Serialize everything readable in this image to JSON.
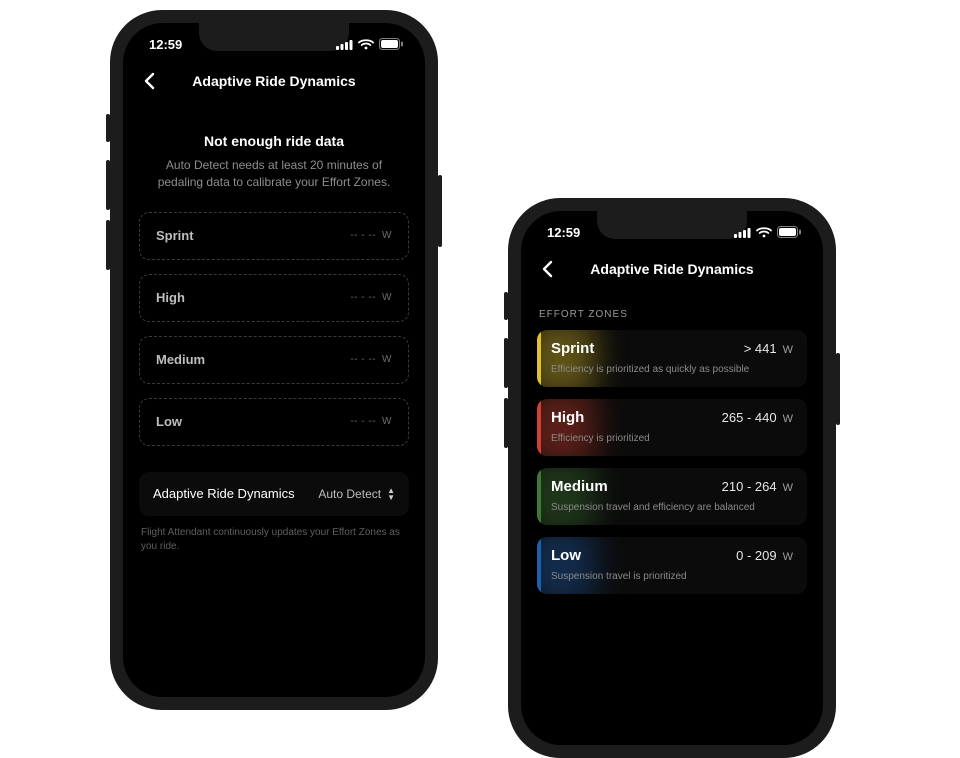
{
  "phoneA": {
    "status": {
      "time": "12:59"
    },
    "nav": {
      "title": "Adaptive Ride Dynamics"
    },
    "empty": {
      "title": "Not enough ride data",
      "subtitle": "Auto Detect needs at least 20 minutes of pedaling data to calibrate your Effort Zones."
    },
    "zones": [
      {
        "name": "Sprint",
        "value": "-- - --",
        "unit": "W"
      },
      {
        "name": "High",
        "value": "-- - --",
        "unit": "W"
      },
      {
        "name": "Medium",
        "value": "-- - --",
        "unit": "W"
      },
      {
        "name": "Low",
        "value": "-- - --",
        "unit": "W"
      }
    ],
    "setting": {
      "label": "Adaptive Ride Dynamics",
      "value": "Auto Detect"
    },
    "footnote": "Flight Attendant continuously updates your Effort Zones as you ride."
  },
  "phoneB": {
    "status": {
      "time": "12:59"
    },
    "nav": {
      "title": "Adaptive Ride Dynamics"
    },
    "section_label": "EFFORT ZONES",
    "zones": [
      {
        "name": "Sprint",
        "value": "> 441",
        "unit": "W",
        "desc": "Efficiency is prioritized as quickly as possible",
        "color": "#e2c22b"
      },
      {
        "name": "High",
        "value": "265 - 440",
        "unit": "W",
        "desc": "Efficiency is prioritized",
        "color": "#d63f2f"
      },
      {
        "name": "Medium",
        "value": "210 - 264",
        "unit": "W",
        "desc": "Suspension travel and efficiency are balanced",
        "color": "#3f7a34"
      },
      {
        "name": "Low",
        "value": "0 - 209",
        "unit": "W",
        "desc": "Suspension travel is prioritized",
        "color": "#1f5fb0"
      }
    ]
  }
}
